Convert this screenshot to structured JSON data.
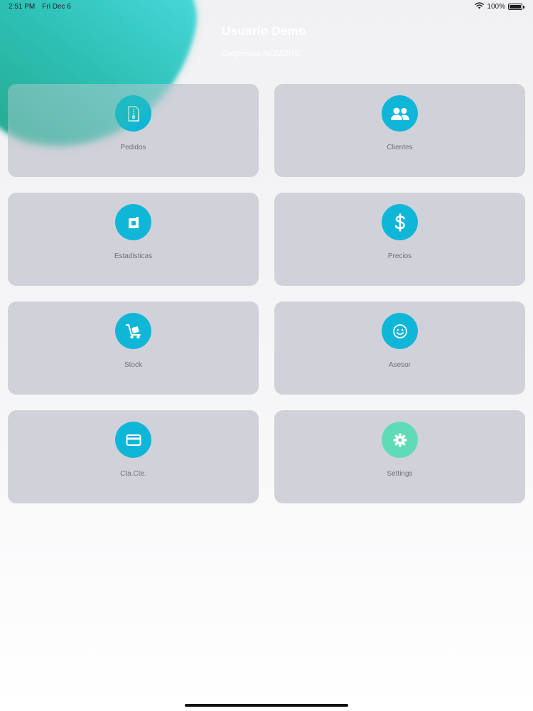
{
  "status_bar": {
    "time": "2:51 PM",
    "date": "Fri Dec 6",
    "battery": "100%"
  },
  "header": {
    "user_name": "Usuario  Demo",
    "company": "Empresaa NOMBRE"
  },
  "menu": {
    "items": [
      {
        "label": "Pedidos",
        "icon": "document-zip-icon",
        "color": "#10b6d8"
      },
      {
        "label": "Clientes",
        "icon": "users-icon",
        "color": "#10b6d8"
      },
      {
        "label": "Estadisticas",
        "icon": "chart-icon",
        "color": "#10b6d8"
      },
      {
        "label": "Precios",
        "icon": "dollar-icon",
        "color": "#10b6d8"
      },
      {
        "label": "Stock",
        "icon": "hand-truck-icon",
        "color": "#10b6d8"
      },
      {
        "label": "Asesor",
        "icon": "smiley-icon",
        "color": "#10b6d8"
      },
      {
        "label": "Cta.Cte.",
        "icon": "credit-card-icon",
        "color": "#10b6d8"
      },
      {
        "label": "Settings",
        "icon": "gear-icon",
        "color": "#5fdcb7"
      }
    ]
  }
}
